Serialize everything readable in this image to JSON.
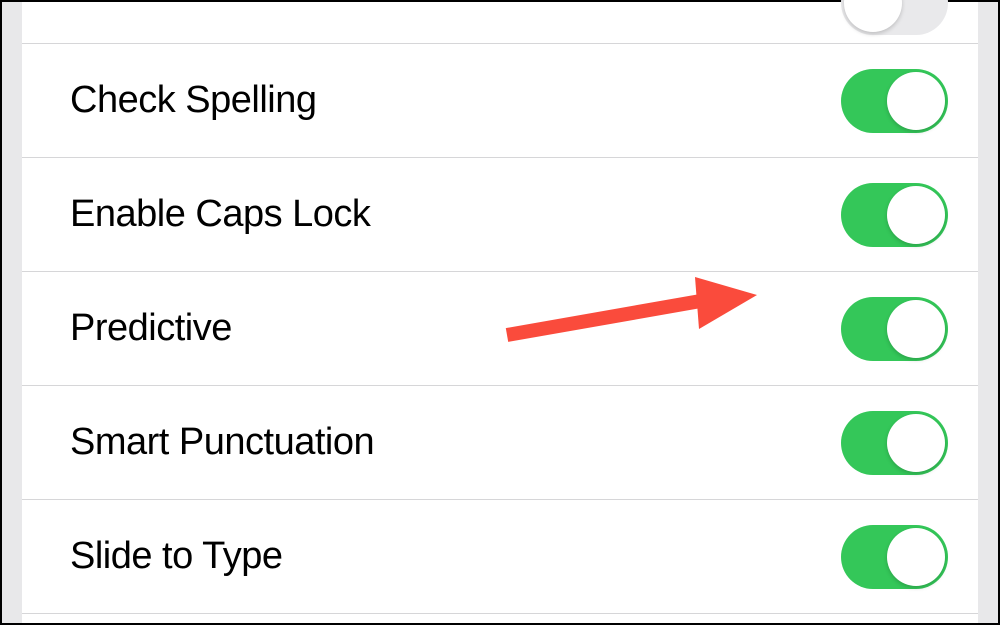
{
  "settings": {
    "rows": [
      {
        "label": "",
        "enabled": false,
        "partial": "top"
      },
      {
        "label": "Check Spelling",
        "enabled": true
      },
      {
        "label": "Enable Caps Lock",
        "enabled": true
      },
      {
        "label": "Predictive",
        "enabled": true,
        "highlighted": true
      },
      {
        "label": "Smart Punctuation",
        "enabled": true
      },
      {
        "label": "Slide to Type",
        "enabled": true
      },
      {
        "label": "",
        "enabled": true,
        "partial": "bottom"
      }
    ]
  },
  "annotation": {
    "arrow_color": "#fa4b3c"
  },
  "colors": {
    "toggle_on": "#34c759",
    "toggle_off": "#e9e9eb",
    "divider": "#d6d6d8"
  }
}
